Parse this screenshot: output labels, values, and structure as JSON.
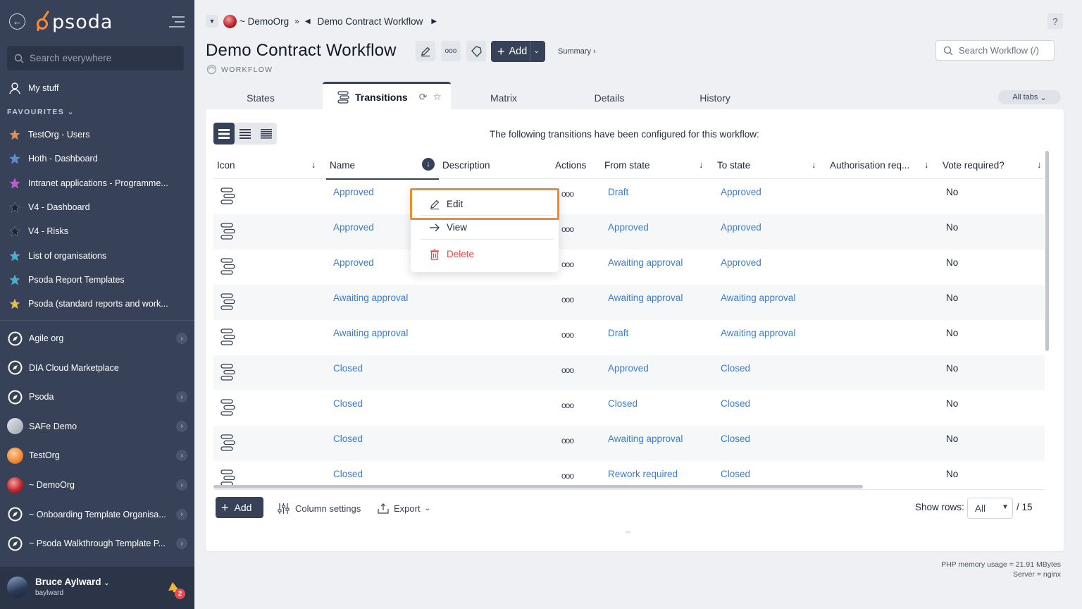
{
  "sidebar": {
    "logo_text": "psoda",
    "search_placeholder": "Search everywhere",
    "my_stuff": "My stuff",
    "favourites_label": "FAVOURITES",
    "favourites": [
      {
        "label": "TestOrg - Users",
        "color": "#f28c38"
      },
      {
        "label": "Hoth - Dashboard",
        "color": "#4a8fe0"
      },
      {
        "label": "Intranet applications - Programme...",
        "color": "#d14fd6"
      },
      {
        "label": "V4 - Dashboard",
        "color": "#1f2430"
      },
      {
        "label": "V4 - Risks",
        "color": "#1f2430"
      },
      {
        "label": "List of organisations",
        "color": "#3cb4d8"
      },
      {
        "label": "Psoda Report Templates",
        "color": "#3cb4d8"
      },
      {
        "label": "Psoda (standard reports and work...",
        "color": "#f2c038"
      }
    ],
    "orgs": [
      {
        "label": "Agile org",
        "icon": "compass-icon",
        "chevron": true
      },
      {
        "label": "DIA Cloud Marketplace",
        "icon": "compass-icon",
        "chevron": false
      },
      {
        "label": "Psoda",
        "icon": "compass-icon",
        "chevron": true
      },
      {
        "label": "SAFe Demo",
        "icon": "safe-logo-icon",
        "chevron": true
      },
      {
        "label": "TestOrg",
        "icon": "orange-ball-icon",
        "chevron": true
      },
      {
        "label": "~ DemoOrg",
        "icon": "red-ball-icon",
        "chevron": true
      },
      {
        "label": "~ Onboarding Template Organisa...",
        "icon": "compass-icon",
        "chevron": true
      },
      {
        "label": "~ Psoda Walkthrough Template P...",
        "icon": "compass-icon",
        "chevron": true
      }
    ],
    "user": {
      "name": "Bruce Aylward",
      "login": "baylward",
      "notifications": "2"
    }
  },
  "header": {
    "org": "~ DemoOrg",
    "crumb": "Demo Contract Workflow",
    "title": "Demo Contract Workflow",
    "add_label": "Add",
    "summary_label": "Summary ›",
    "subtitle": "WORKFLOW",
    "search_placeholder": "Search Workflow (/)",
    "help": "?"
  },
  "tabs": {
    "states": "States",
    "transitions": "Transitions",
    "matrix": "Matrix",
    "details": "Details",
    "history": "History",
    "all_tabs": "All tabs"
  },
  "panel": {
    "intro": "The following transitions have been configured for this workflow:",
    "columns": [
      "Icon",
      "Name",
      "Description",
      "Actions",
      "From state",
      "To state",
      "Authorisation req...",
      "Vote required?"
    ],
    "rows": [
      {
        "name": "Approved",
        "from": "Draft",
        "to": "Approved",
        "vote": "No"
      },
      {
        "name": "Approved",
        "from": "Approved",
        "to": "Approved",
        "vote": "No"
      },
      {
        "name": "Approved",
        "from": "Awaiting approval",
        "to": "Approved",
        "vote": "No"
      },
      {
        "name": "Awaiting approval",
        "from": "Awaiting approval",
        "to": "Awaiting approval",
        "vote": "No"
      },
      {
        "name": "Awaiting approval",
        "from": "Draft",
        "to": "Awaiting approval",
        "vote": "No"
      },
      {
        "name": "Closed",
        "from": "Approved",
        "to": "Closed",
        "vote": "No"
      },
      {
        "name": "Closed",
        "from": "Closed",
        "to": "Closed",
        "vote": "No"
      },
      {
        "name": "Closed",
        "from": "Awaiting approval",
        "to": "Closed",
        "vote": "No"
      },
      {
        "name": "Closed",
        "from": "Rework required",
        "to": "Closed",
        "vote": "No"
      }
    ],
    "actions_glyph": "ooo",
    "footer": {
      "add": "Add",
      "column_settings": "Column settings",
      "export": "Export",
      "show_rows_label": "Show rows:",
      "show_rows_value": "All",
      "total": "/ 15"
    }
  },
  "context_menu": {
    "edit": "Edit",
    "view": "View",
    "delete": "Delete"
  },
  "footer_info": {
    "memory": "PHP memory usage = 21.91 MBytes",
    "server": "Server = nginx"
  },
  "colors": {
    "sidebar_bg": "#374157",
    "link": "#3d7cc9",
    "highlight": "#f08a2c",
    "danger": "#e5484d"
  }
}
